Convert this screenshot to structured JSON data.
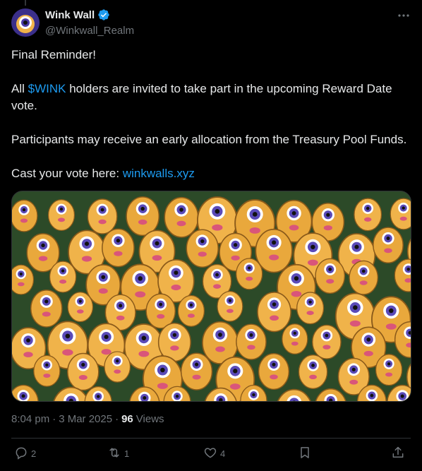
{
  "author": {
    "display_name": "Wink Wall",
    "handle": "@Winkwall_Realm",
    "verified": true
  },
  "post": {
    "line1": "Final Reminder!",
    "line2_pre": "All ",
    "cashtag": "$WINK",
    "line2_post": " holders are invited to take part in the upcoming Reward Date vote.",
    "line3": "Participants may receive an early allocation from the Treasury Pool Funds.",
    "line4_pre": "Cast your vote here: ",
    "link": "winkwalls.xyz"
  },
  "meta": {
    "time": "8:04 pm",
    "sep1": "·",
    "date": "3 Mar 2025",
    "sep2": "·",
    "views_count": "96",
    "views_label": "Views"
  },
  "actions": {
    "replies": "2",
    "reposts": "1",
    "likes": "4"
  },
  "colors": {
    "background": "#000000",
    "text": "#e7e9ea",
    "muted": "#71767b",
    "link": "#1d9bf0",
    "verified": "#1d9bf0"
  },
  "icons": [
    "more-icon",
    "verified-icon",
    "reply-icon",
    "repost-icon",
    "like-icon",
    "bookmark-icon",
    "share-icon"
  ]
}
